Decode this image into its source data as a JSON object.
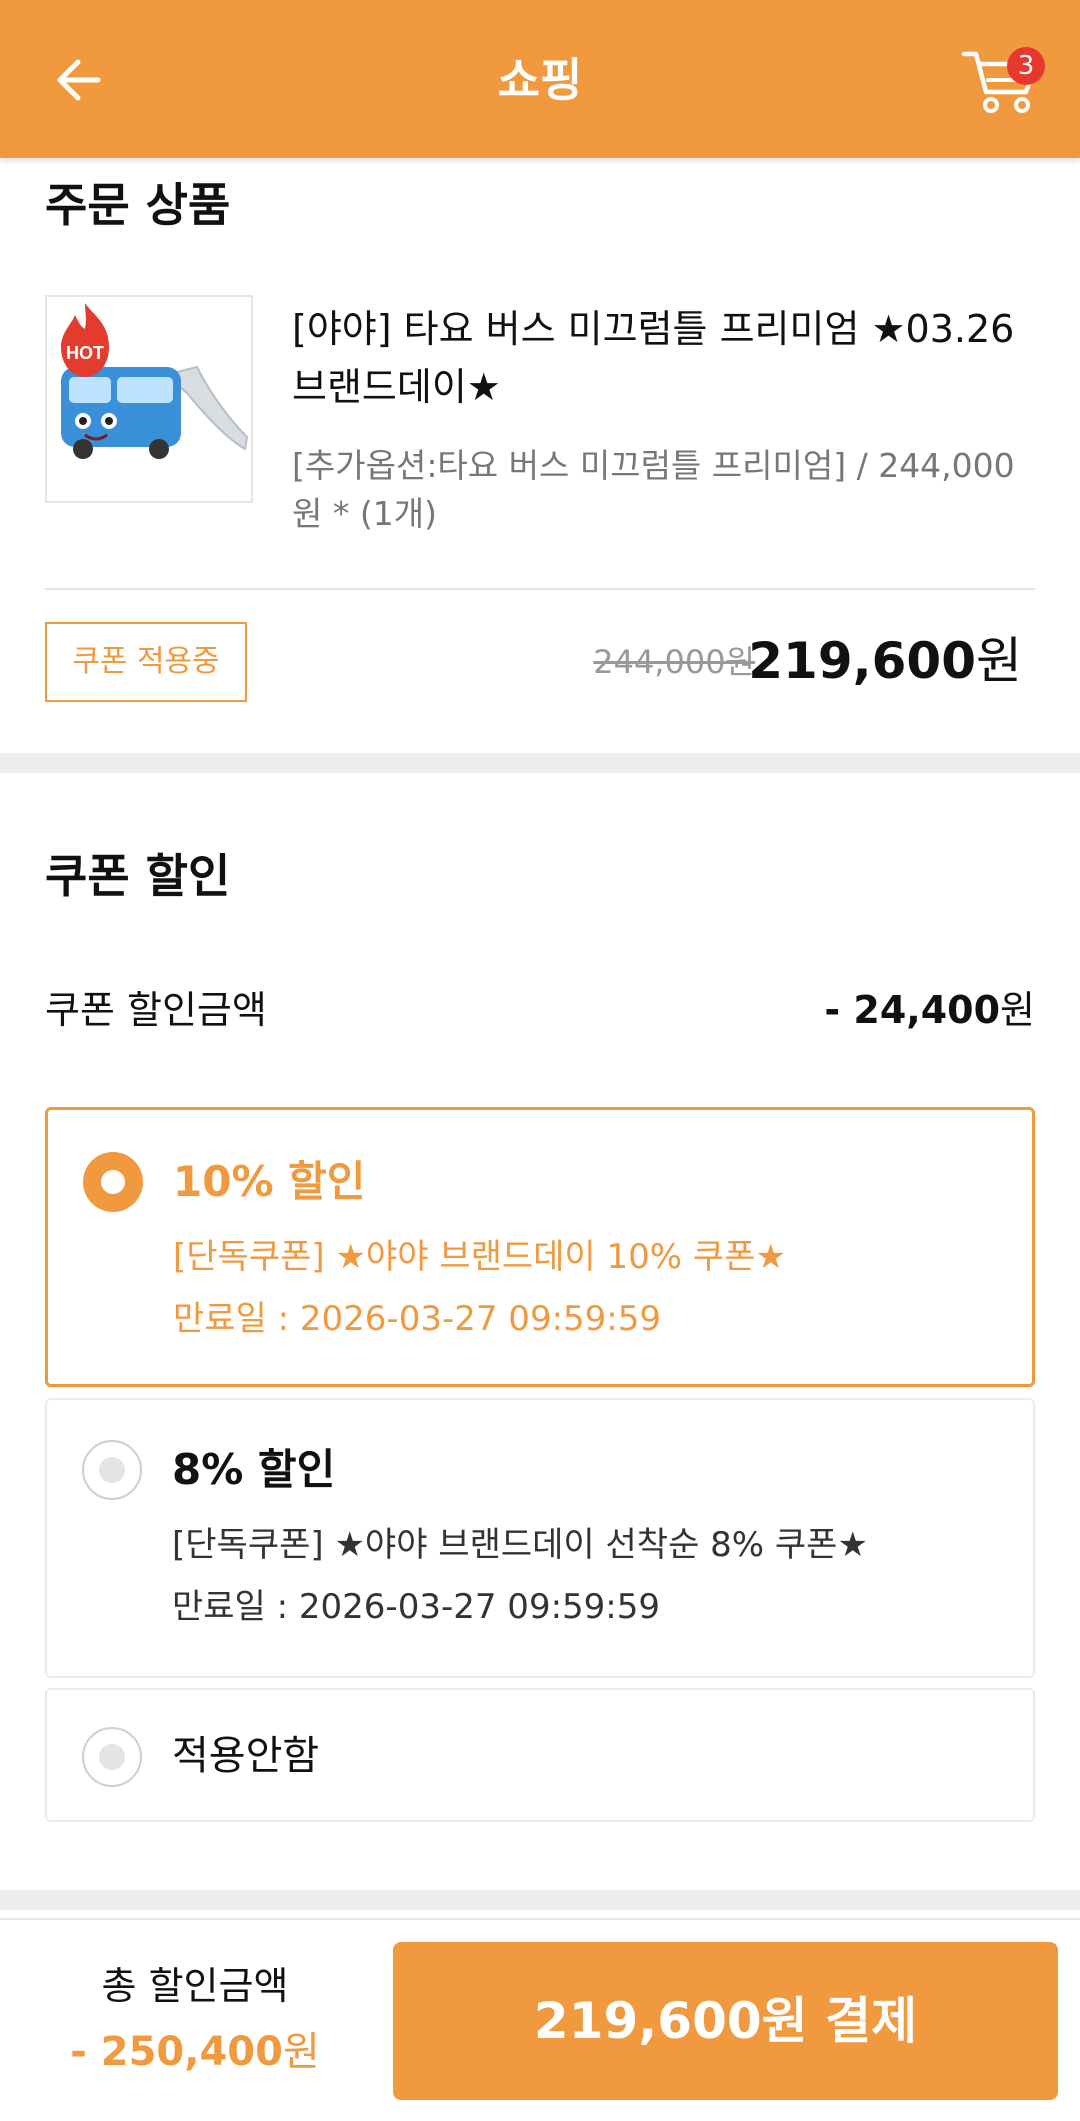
{
  "header": {
    "title": "쇼핑",
    "cart_count": "3",
    "brand_color": "#F0993E"
  },
  "order": {
    "section_title": "주문 상품",
    "product": {
      "thumbnail_badge": "HOT",
      "name": "[야야] 타요 버스 미끄럼틀 프리미엄 ★03.26 브랜드데이★",
      "option": "[추가옵션:타요 버스 미끄럼틀 프리미엄] / 244,000원 * (1개)"
    },
    "coupon_applied_label": "쿠폰 적용중",
    "original_price": "244,000원",
    "final_price_number": "219,600",
    "final_price_unit": "원"
  },
  "coupon": {
    "section_title": "쿠폰 할인",
    "discount_label": "쿠폰 할인금액",
    "discount_amount_prefix": "- ",
    "discount_amount_number": "24,400",
    "discount_amount_unit": "원",
    "options": [
      {
        "title": "10% 할인",
        "description": "[단독쿠폰] ★야야 브랜드데이 10% 쿠폰★",
        "expiry": "만료일 : 2026-03-27 09:59:59",
        "selected": true
      },
      {
        "title": "8% 할인",
        "description": "[단독쿠폰] ★야야 브랜드데이 선착순 8% 쿠폰★",
        "expiry": "만료일 : 2026-03-27 09:59:59",
        "selected": false
      },
      {
        "title": "적용안함",
        "selected": false
      }
    ]
  },
  "bottom_bar": {
    "total_label": "총 할인금액",
    "total_amount_number": "- 250,400",
    "total_amount_unit": "원",
    "pay_button_label": "219,600원 결제"
  }
}
